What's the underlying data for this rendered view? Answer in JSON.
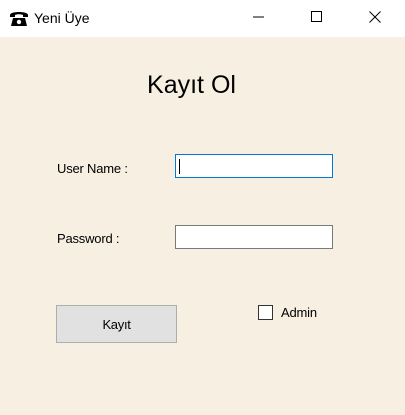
{
  "window": {
    "title": "Yeni Üye",
    "icon": "telephone-icon"
  },
  "titlebar_controls": {
    "minimize": "minimize-icon",
    "maximize": "maximize-icon",
    "close": "close-icon"
  },
  "form": {
    "heading": "Kayıt Ol",
    "username_label": "User Name  :",
    "username_value": "",
    "password_label": "Password   :",
    "password_value": "",
    "submit_label": "Kayıt",
    "admin_label": "Admin",
    "admin_checked": false
  },
  "colors": {
    "client_background": "#f6efe2",
    "focus_border": "#0078d7",
    "button_face": "#e1e1e1"
  }
}
